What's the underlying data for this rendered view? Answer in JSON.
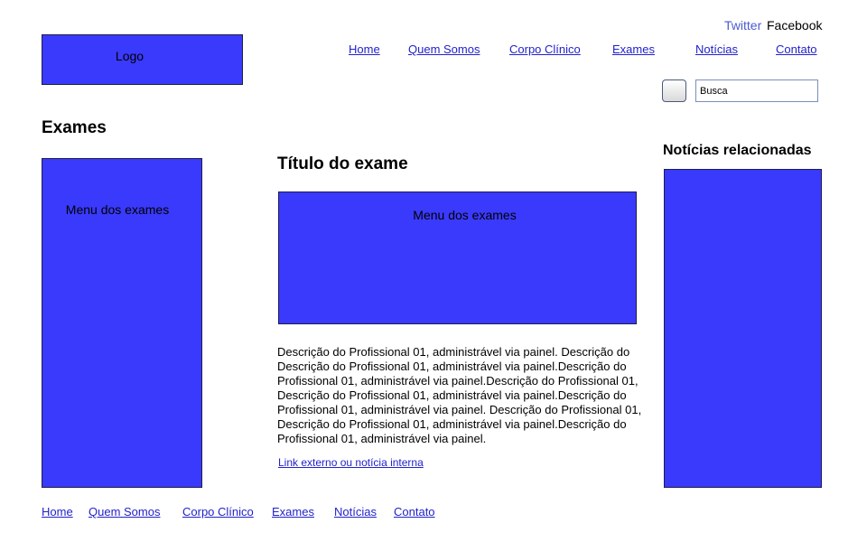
{
  "colors": {
    "accent_box": "#3a3afc",
    "link": "#2222cc"
  },
  "header": {
    "logo_label": "Logo",
    "social": {
      "twitter": "Twitter",
      "facebook": "Facebook"
    },
    "nav": {
      "home": "Home",
      "quem_somos": "Quem Somos",
      "corpo_clinico": "Corpo Clínico",
      "exames": "Exames",
      "noticias": "Notícias",
      "contato": "Contato"
    },
    "search": {
      "value": "Busca"
    }
  },
  "page": {
    "title": "Exames"
  },
  "left_sidebar": {
    "label": "Menu dos exames"
  },
  "main": {
    "title": "Título do exame",
    "media_label": "Menu dos exames",
    "description": "Descrição do Profissional 01, administrável via painel. Descrição do Descrição do Profissional 01, administrável via painel.Descrição do Profissional 01, administrável via painel.Descrição do Profissional 01, Descrição do Profissional 01, administrável via painel.Descrição do Profissional 01, administrável via painel. Descrição do Profissional 01, Descrição do Profissional 01, administrável via painel.Descrição do Profissional 01, administrável via painel.",
    "link": "Link externo ou notícia interna"
  },
  "right_sidebar": {
    "title": "Notícias relacionadas"
  },
  "footer": {
    "nav": {
      "home": "Home",
      "quem_somos": "Quem Somos",
      "corpo_clinico": "Corpo Clínico",
      "exames": "Exames",
      "noticias": "Notícias",
      "contato": "Contato"
    }
  }
}
